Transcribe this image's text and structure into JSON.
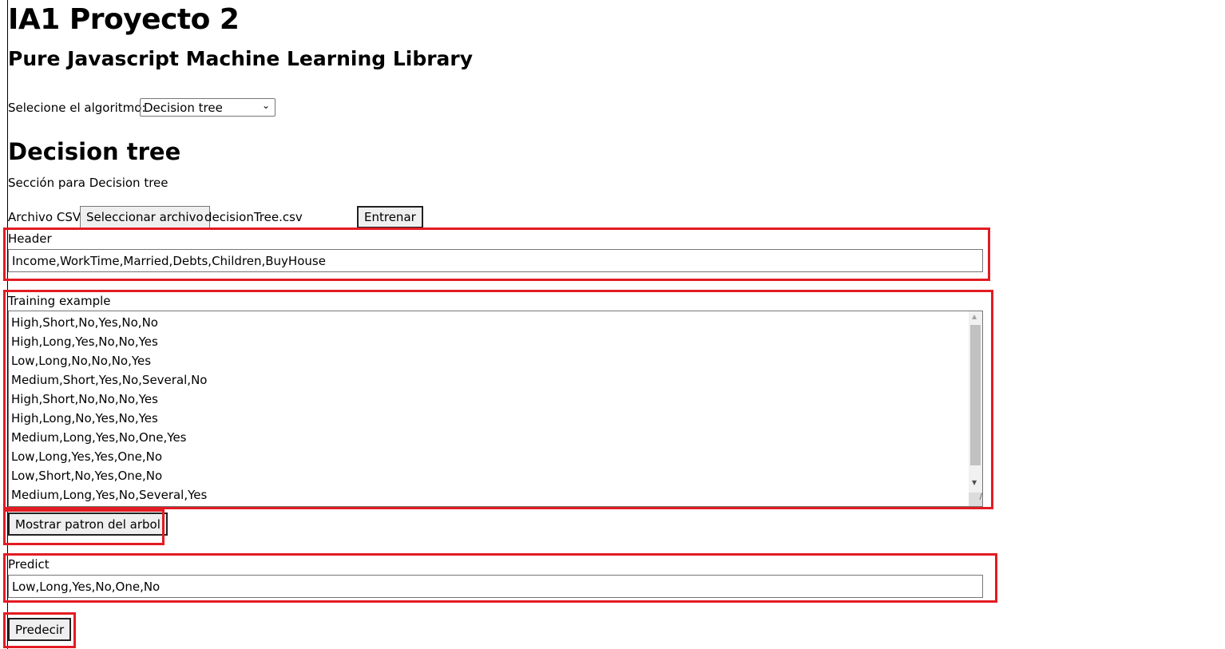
{
  "page": {
    "title": "IA1 Proyecto 2",
    "subtitle": "Pure Javascript Machine Learning Library"
  },
  "algorithm": {
    "label": "Selecione el algoritmo:",
    "selected": "Decision tree"
  },
  "section": {
    "heading": "Decision tree",
    "description": "Sección para Decision tree",
    "file_label": "Archivo CSV",
    "file_button": "Seleccionar archivo",
    "file_name": "decisionTree.csv",
    "train_button": "Entrenar"
  },
  "header": {
    "label": "Header",
    "value": "Income,WorkTime,Married,Debts,Children,BuyHouse"
  },
  "training": {
    "label": "Training example",
    "lines": [
      "High,Short,No,Yes,No,No",
      "High,Long,Yes,No,No,Yes",
      "Low,Long,No,No,No,Yes",
      "Medium,Short,Yes,No,Several,No",
      "High,Short,No,No,No,Yes",
      "High,Long,No,Yes,No,Yes",
      "Medium,Long,Yes,No,One,Yes",
      "Low,Long,Yes,Yes,One,No",
      "Low,Short,No,Yes,One,No",
      "Medium,Long,Yes,No,Several,Yes"
    ]
  },
  "show_tree_button": "Mostrar patron del arbol",
  "predict": {
    "label": "Predict",
    "value": "Low,Long,Yes,No,One,No",
    "button": "Predecir"
  },
  "colors": {
    "highlight": "#e31b23"
  }
}
